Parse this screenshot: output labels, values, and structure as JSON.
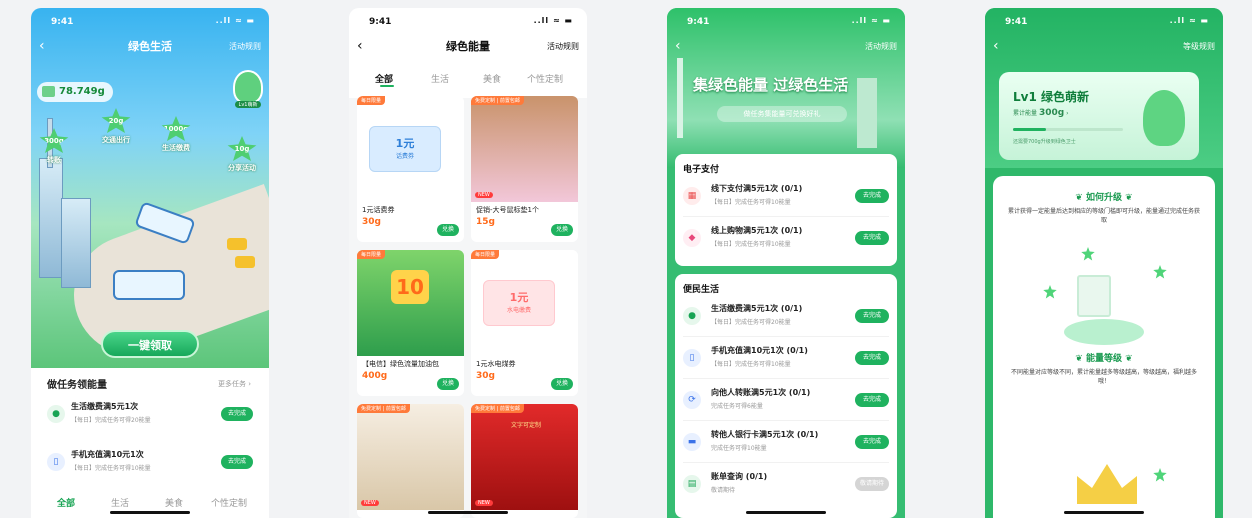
{
  "status_time": "9:41",
  "status_icons": "..ll ≈ ▬",
  "p1": {
    "title": "绿色生活",
    "rule": "活动规则",
    "energy": "78.749g",
    "badge": "Lv1萌新",
    "bubbles": [
      {
        "amount": "300g",
        "label": "转账"
      },
      {
        "amount": "20g",
        "label": "交通出行"
      },
      {
        "amount": "1000g",
        "label": "生活缴费"
      },
      {
        "amount": "10g",
        "label": "分享活动"
      }
    ],
    "claim": "一键领取",
    "task_header": "做任务领能量",
    "more": "更多任务 ›",
    "tasks": [
      {
        "name": "生活缴费满5元1次",
        "sub": "【每日】完成任务可得20能量",
        "btn": "去完成"
      },
      {
        "name": "手机充值满10元1次",
        "sub": "【每日】完成任务可得10能量",
        "btn": "去完成"
      }
    ],
    "tabs": [
      "全部",
      "生活",
      "美食",
      "个性定制"
    ]
  },
  "p2": {
    "title": "绿色能量",
    "rule": "活动规则",
    "tabs": [
      "全部",
      "生活",
      "美食",
      "个性定制"
    ],
    "products": [
      {
        "tag": "每日限量",
        "coupon": "1元",
        "coupon_sub": "话费券",
        "name": "1元话费券",
        "price": "30g",
        "btn": "兑换"
      },
      {
        "tag": "免费定制 | 前置包邮",
        "name": "促销-大号鼠标垫1个",
        "price": "15g",
        "btn": "兑换",
        "new": "NEW"
      },
      {
        "tag": "每日限量",
        "name": "【电信】绿色流量加油包",
        "price": "400g",
        "btn": "兑换",
        "big": "10"
      },
      {
        "tag": "每日限量",
        "coupon": "1元",
        "coupon_sub": "水电缴费",
        "name": "1元水电煤券",
        "price": "30g",
        "btn": "兑换"
      },
      {
        "tag": "免费定制 | 前置包邮",
        "new": "NEW"
      },
      {
        "tag": "免费定制 | 前置包邮",
        "new": "NEW",
        "text": "文字可定制"
      }
    ]
  },
  "p3": {
    "rule": "活动规则",
    "hero": "集绿色能量 过绿色生活",
    "hero_sub": "做任务集能量可兑换好礼",
    "sec1": "电子支付",
    "sec1_rows": [
      {
        "name": "线下支付满5元1次 (0/1)",
        "sub": "【每日】完成任务可得10能量",
        "btn": "去完成"
      },
      {
        "name": "线上购物满5元1次 (0/1)",
        "sub": "【每日】完成任务可得10能量",
        "btn": "去完成"
      }
    ],
    "sec2": "便民生活",
    "sec2_rows": [
      {
        "name": "生活缴费满5元1次 (0/1)",
        "sub": "【每日】完成任务可得20能量",
        "btn": "去完成"
      },
      {
        "name": "手机充值满10元1次 (0/1)",
        "sub": "【每日】完成任务可得10能量",
        "btn": "去完成"
      },
      {
        "name": "向他人转账满5元1次 (0/1)",
        "sub": "完成任务可得6能量",
        "btn": "去完成"
      },
      {
        "name": "转他人银行卡满5元1次 (0/1)",
        "sub": "完成任务可得10能量",
        "btn": "去完成"
      },
      {
        "name": "账单查询 (0/1)",
        "sub": "敬请期待",
        "btn": "敬请期待"
      }
    ]
  },
  "p4": {
    "rule": "等级规则",
    "level": "Lv1 绿色萌新",
    "acc_label": "累计能量",
    "acc_value": "300g",
    "next": "还需要700g升级到绿色卫士",
    "progress": 0.3,
    "how_title": "如何升级",
    "how_desc": "累计获得一定能量后达到相应的等级门槛即可升级，能量通过完成任务获取",
    "lv_title": "能量等级",
    "lv_desc": "不同能量对应等级不同，累计能量越多等级越高，等级越高，福利越多哦！"
  }
}
